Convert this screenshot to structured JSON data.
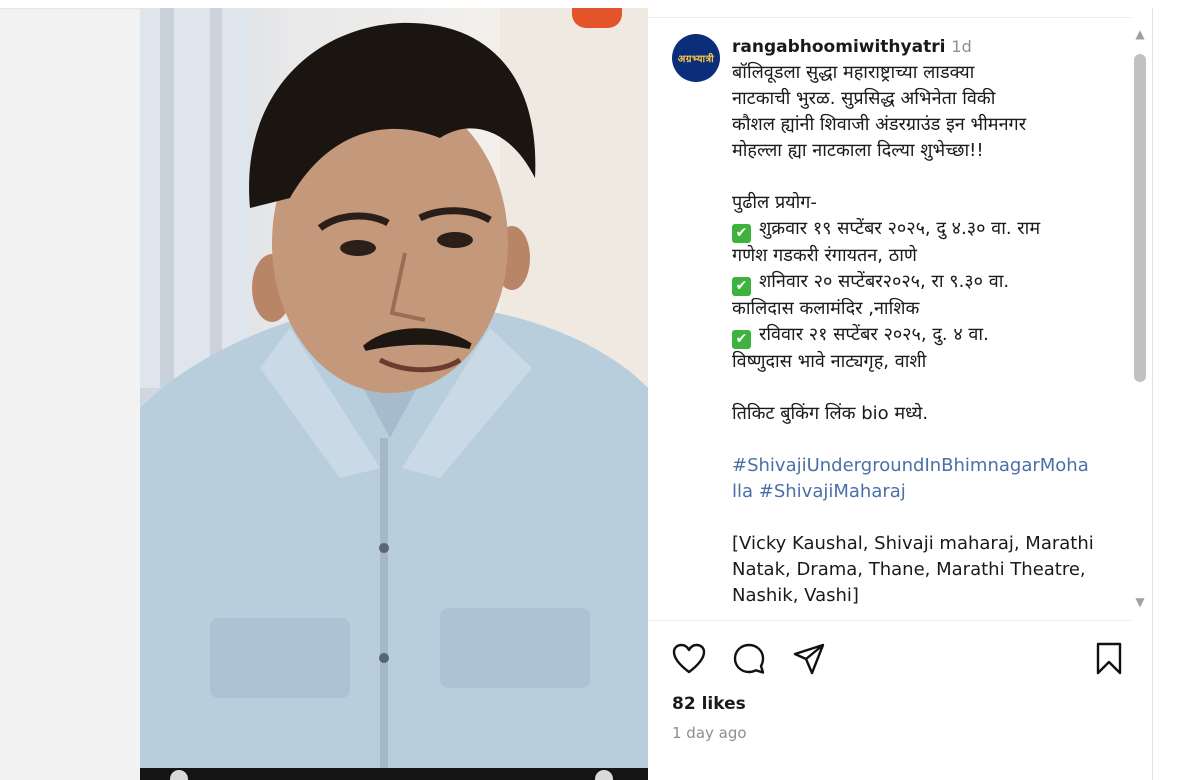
{
  "post": {
    "avatar_text": "अग्रभ्यात्री",
    "username": "rangabhoomiwithyatri",
    "time": "1d",
    "caption_lines": [
      "बॉलिवूडला सुद्धा महाराष्ट्राच्या लाडक्या",
      "नाटकाची भुरळ. सुप्रसिद्ध अभिनेता विकी",
      "कौशल ह्यांनी शिवाजी अंडरग्राउंड इन भीमनगर",
      "मोहल्ला ह्या नाटकाला दिल्या शुभेच्छा!!"
    ],
    "schedule_title": "पुढील प्रयोग-",
    "shows": [
      {
        "line1": "शुक्रवार १९ सप्टेंबर २०२५, दु ४.३० वा. राम",
        "line2": "गणेश गडकरी रंगायतन, ठाणे"
      },
      {
        "line1": "शनिवार २० सप्टेंबर२०२५, रा ९.३० वा.",
        "line2": "कालिदास कलामंदिर ,नाशिक"
      },
      {
        "line1": "रविवार २१ सप्टेंबर २०२५, दु. ४ वा.",
        "line2": "विष्णुदास भावे नाट्यगृह, वाशी"
      }
    ],
    "ticket_line": "तिकिट बुकिंग लिंक bio मध्ये.",
    "hashtag_line1": "#ShivajiUndergroundInBhimnagarMoha",
    "hashtag_line2": "lla #ShivajiMaharaj",
    "tags_line1": "[Vicky Kaushal, Shivaji maharaj, Marathi",
    "tags_line2": "Natak, Drama, Thane, Marathi Theatre,",
    "tags_line3": "Nashik, Vashi]",
    "likes": "82 likes",
    "posted_ago": "1 day ago"
  },
  "icons": {
    "like": "heart-icon",
    "comment": "comment-icon",
    "share": "send-icon",
    "save": "bookmark-icon",
    "check": "check-mark-icon",
    "scroll_up": "scroll-up-icon",
    "scroll_down": "scroll-down-icon"
  },
  "colors": {
    "hashtag": "#4b6fa8",
    "check_green": "#3db33d",
    "avatar_bg": "#0c2d7a",
    "muted_text": "#8e8e8e"
  }
}
